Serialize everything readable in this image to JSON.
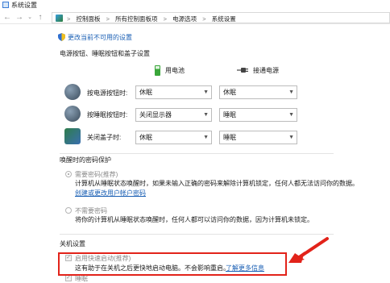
{
  "window": {
    "title": "系统设置"
  },
  "address": {
    "crumbs": [
      "控制面板",
      "所有控制面板项",
      "电源选项",
      "系统设置"
    ],
    "separator": ">"
  },
  "change_unavailable": {
    "label": "更改当前不可用的设置"
  },
  "power_section": {
    "title": "电源按钮、睡眠按钮和盖子设置",
    "battery_label": "用电池",
    "plugged_label": "接通电源",
    "rows": [
      {
        "label": "按电源按钮时:",
        "battery": "休眠",
        "plugged": "休眠"
      },
      {
        "label": "按睡眠按钮时:",
        "battery": "关闭显示器",
        "plugged": "睡眠"
      },
      {
        "label": "关闭盖子时:",
        "battery": "休眠",
        "plugged": "睡眠"
      }
    ]
  },
  "password_section": {
    "title": "唤醒时的密码保护",
    "require": {
      "label": "需要密码(推荐)",
      "desc": "计算机从睡眠状态唤醒时，如果未输入正确的密码来解除计算机锁定，任何人都无法访问你的数据。",
      "link": "创建或更改用户帐户密码"
    },
    "no_require": {
      "label": "不需要密码",
      "desc": "将你的计算机从睡眠状态唤醒时，任何人都可以访问你的数据，因为计算机未锁定。"
    }
  },
  "shutdown_section": {
    "title": "关机设置",
    "fast_startup": {
      "label": "启用快速启动(推荐)",
      "desc": "这有助于在关机之后更快地启动电脑。不会影响重启。",
      "learn_more": "了解更多信息"
    },
    "sleep": {
      "label": "睡眠"
    }
  },
  "colors": {
    "annotation": "#e2231a",
    "link": "#1a5fb4"
  }
}
